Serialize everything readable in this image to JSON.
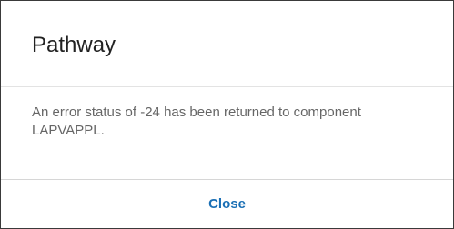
{
  "dialog": {
    "title": "Pathway",
    "message": "An error status of -24 has been returned to component LAPVAPPL.",
    "close_label": "Close"
  },
  "colors": {
    "title_text": "#222222",
    "message_text": "#666666",
    "button_text": "#1a6fb5",
    "border": "#3a3a3a",
    "divider": "#e3e3e3"
  }
}
